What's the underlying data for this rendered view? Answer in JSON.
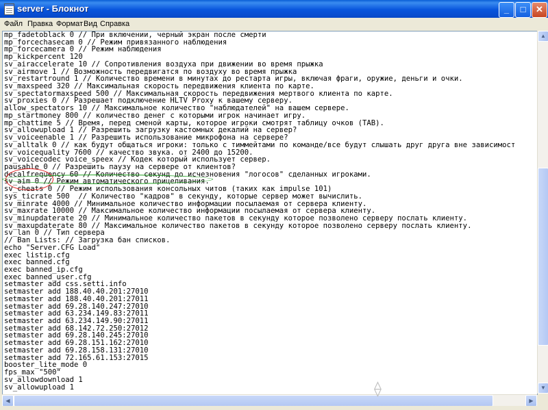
{
  "window": {
    "title": "server - Блокнот",
    "buttons": {
      "minimize": "_",
      "maximize": "□",
      "close": "✕"
    }
  },
  "menu": [
    "Файл",
    "Правка",
    "Формат",
    "Вид",
    "Справка"
  ],
  "editor": {
    "lines": [
      "mp_fadetoblack 0 // При включении, черный экран после смерти",
      "mp_forcechasecam 0 // Режим привязанного наблюдения",
      "mp_forcecamera 0 // Режим наблюдения",
      "mp_kickpercent 120",
      "sv_airaccelerate 10 // Сопротивления воздуха при движении во время прыжка",
      "sv_airmove 1 // Возможность передвигатся по воздуху во время прыжка",
      "sv_restartround 1 // Количество времени в минутах до рестарта игры, включая фраги, оружие, деньги и очки.",
      "sv_maxspeed 320 // Максимальная скорость передвижения клиента по карте.",
      "sv_spectatormaxspeed 500 // Максимальная скорость передвижения мертвого клиента по карте.",
      "sv_proxies 0 // Разрешает подключение HLTV Proxy к вашему серверу.",
      "allow_spectators 10 // Максимальное количество \"наблюдателей\" на вашем сервере.",
      "mp_startmoney 800 // количество денег с которыми игрок начинает игру.",
      "mp_chattime 5 // Время, перед сменой карты, которое игроки смотрят таблицу очков (TAB).",
      "sv_allowupload 1 // Разрешить загрузку кастомных декалий на сервер?",
      "sv_voiceenable 1 // Разрешить использование микрофона на сервере?",
      "sv_alltalk 0 // как будут общаться игроки: только с тиммейтами по команде/все будут слышать друг друга вне зависимост",
      "sv_voicequality 7600 // качество звука. от 2400 до 15200.",
      "sv_voicecodec voice_speex // Кодек который использует сервер.",
      "pausable 0 // Разрешить паузу на сервере от клиентов?",
      "decalfrequency 60 // Количество секунд до исчезновения \"логосов\" сделанных игроками.",
      "sv_aim 0 // Режим автоматического прицеливания.",
      "sv_cheats 0 // Режим использования консольных читов (таких как impulse 101)",
      "sys_ticrate 500  // Количество \"кадров\" в секунду, которые сервер может вычислить.",
      "sv_minrate 4000 // Минимальное количество информации посылаемая от сервера клиенту.",
      "sv_maxrate 10000 // Максимальное количество информации посылаемая от сервера клиенту.",
      "sv_minupdaterate 20 // Минимальное количество пакетов в секунду которое позволено серверу послать клиенту.",
      "sv_maxupdaterate 80 // Максимальное количество пакетов в секунду которое позволено серверу послать клиенту.",
      "sv_lan 0 // Тип сервера",
      "// Ban Lists: // Загрузка бан списков.",
      "echo \"Server.CFG Load\"",
      "exec listip.cfg",
      "exec banned.cfg",
      "exec banned_ip.cfg",
      "exec banned_user.cfg",
      "setmaster add css.setti.info",
      "setmaster add 188.40.40.201:27010",
      "setmaster add 188.40.40.201:27011",
      "setmaster add 69.28.140.247:27010",
      "setmaster add 63.234.149.83:27011",
      "setmaster add 63.234.149.90:27011",
      "setmaster add 68.142.72.250:27012",
      "setmaster add 69.28.140.245:27010",
      "setmaster add 69.28.151.162:27010",
      "setmaster add 69.28.158.131:27010",
      "setmaster add 72.165.61.153:27015",
      "booster_lite_mode 0",
      "fps_max \"500\"",
      "sv_allowdownload 1",
      "sv_allowupload 1"
    ]
  },
  "scrollbar": {
    "up": "▲",
    "down": "▼",
    "left": "◀",
    "right": "▶"
  },
  "cursor_glyph": "⟠",
  "colors": {
    "title_bar": "#0855dd",
    "annotation_red": "#e02020",
    "annotation_green": "#22a022"
  }
}
